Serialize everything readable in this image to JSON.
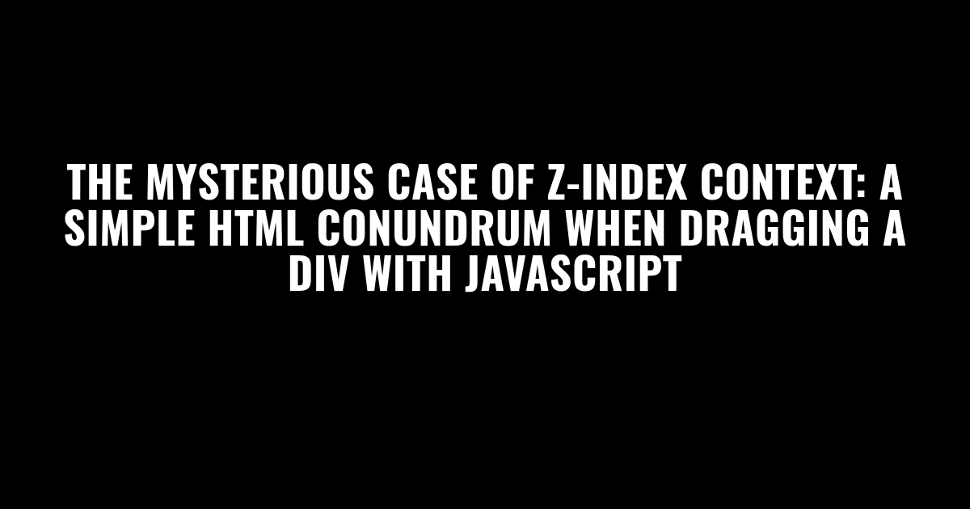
{
  "title": "The Mysterious Case of Z-Index Context: A Simple HTML Conundrum When Dragging a Div with JavaScript"
}
